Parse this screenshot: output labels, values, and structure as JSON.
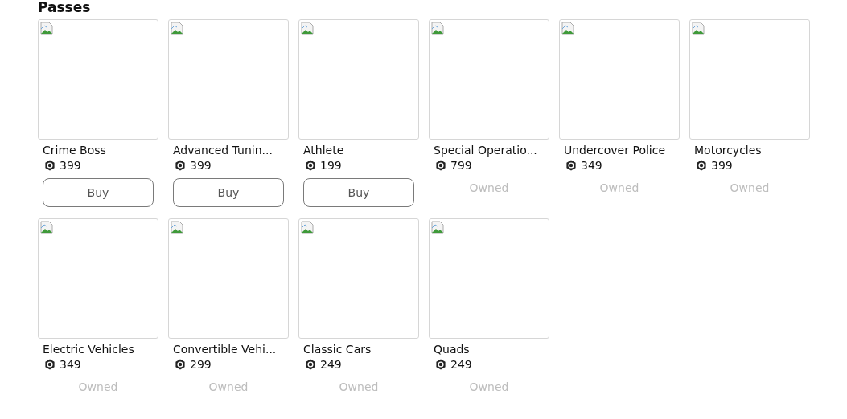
{
  "title": "Passes",
  "passes": [
    {
      "name": "Crime Boss",
      "price": "399",
      "owned": false,
      "action": "Buy"
    },
    {
      "name": "Advanced Tunin...",
      "price": "399",
      "owned": false,
      "action": "Buy"
    },
    {
      "name": "Athlete",
      "price": "199",
      "owned": false,
      "action": "Buy"
    },
    {
      "name": "Special Operatio...",
      "price": "799",
      "owned": true,
      "action": "Owned"
    },
    {
      "name": "Undercover Police",
      "price": "349",
      "owned": true,
      "action": "Owned"
    },
    {
      "name": "Motorcycles",
      "price": "399",
      "owned": true,
      "action": "Owned"
    },
    {
      "name": "Electric Vehicles",
      "price": "349",
      "owned": true,
      "action": "Owned"
    },
    {
      "name": "Convertible Vehi...",
      "price": "299",
      "owned": true,
      "action": "Owned"
    },
    {
      "name": "Classic Cars",
      "price": "249",
      "owned": true,
      "action": "Owned"
    },
    {
      "name": "Quads",
      "price": "249",
      "owned": true,
      "action": "Owned"
    }
  ]
}
